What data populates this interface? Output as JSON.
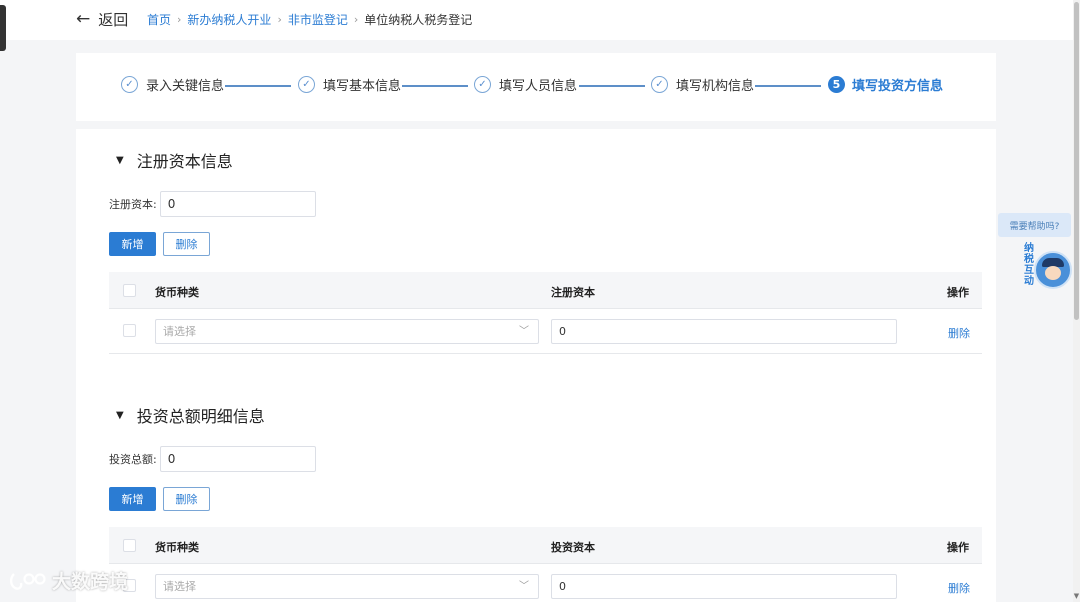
{
  "header": {
    "back_label": "返回",
    "breadcrumb": [
      "首页",
      "新办纳税人开业",
      "非市监登记"
    ],
    "current_page": "单位纳税人税务登记"
  },
  "steps": [
    {
      "label": "录入关键信息",
      "done": true
    },
    {
      "label": "填写基本信息",
      "done": true
    },
    {
      "label": "填写人员信息",
      "done": true
    },
    {
      "label": "填写机构信息",
      "done": true
    },
    {
      "label": "填写投资方信息",
      "done": false,
      "number": "5"
    }
  ],
  "registered_capital": {
    "title": "注册资本信息",
    "field_label": "注册资本:",
    "field_value": "0",
    "add_label": "新增",
    "delete_label": "删除",
    "columns": [
      "货币种类",
      "注册资本",
      "操作"
    ],
    "rows": [
      {
        "currency_placeholder": "请选择",
        "amount": "0",
        "action": "删除"
      }
    ]
  },
  "investment": {
    "title": "投资总额明细信息",
    "field_label": "投资总额:",
    "field_value": "0",
    "add_label": "新增",
    "delete_label": "删除",
    "columns": [
      "货币种类",
      "投资资本",
      "操作"
    ],
    "rows": [
      {
        "currency_placeholder": "请选择",
        "amount": "0",
        "action": "删除"
      }
    ]
  },
  "help": {
    "bubble": "需要帮助吗?",
    "widget_text": "纳税互动"
  },
  "watermark": "大数跨境",
  "colors": {
    "accent": "#2b7cd3",
    "background": "#f4f5f7"
  }
}
